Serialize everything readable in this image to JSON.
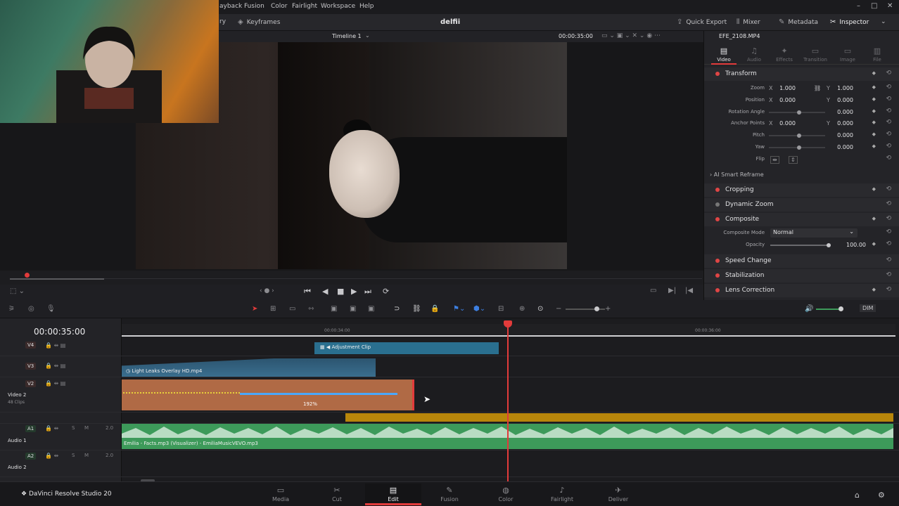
{
  "menu": {
    "items": [
      "ayback",
      "Fusion",
      "Color",
      "Fairlight",
      "Workspace",
      "Help"
    ]
  },
  "window": {
    "minimize": "–",
    "maximize": "□",
    "close": "✕"
  },
  "toolbar": {
    "left_label": "ry",
    "keyframes": "Keyframes",
    "project_title": "delfii",
    "quick_export": "Quick Export",
    "mixer": "Mixer",
    "metadata": "Metadata",
    "inspector": "Inspector"
  },
  "viewer": {
    "timeline_name": "Timeline 1",
    "timecode": "00:00:35:00",
    "clip_name": "EFE_2108.MP4",
    "nav": "‹ ● ›"
  },
  "inspector": {
    "tabs": [
      {
        "label": "Video",
        "icon": "▤"
      },
      {
        "label": "Audio",
        "icon": "♫"
      },
      {
        "label": "Effects",
        "icon": "✦"
      },
      {
        "label": "Transition",
        "icon": "▭"
      },
      {
        "label": "Image",
        "icon": "▭"
      },
      {
        "label": "File",
        "icon": "▥"
      }
    ],
    "transform": "Transform",
    "zoom": {
      "label": "Zoom",
      "x": "1.000",
      "y": "1.000"
    },
    "position": {
      "label": "Position",
      "x": "0.000",
      "y": "0.000"
    },
    "rotation": {
      "label": "Rotation Angle",
      "value": "0.000"
    },
    "anchor": {
      "label": "Anchor Points",
      "x": "0.000",
      "y": "0.000"
    },
    "pitch": {
      "label": "Pitch",
      "value": "0.000"
    },
    "yaw": {
      "label": "Yaw",
      "value": "0.000"
    },
    "flip": {
      "label": "Flip"
    },
    "x_axis": "X",
    "y_axis": "Y",
    "ai_reframe": "AI Smart Reframe",
    "cropping": "Cropping",
    "dynamic_zoom": "Dynamic Zoom",
    "composite": "Composite",
    "composite_mode": {
      "label": "Composite Mode",
      "value": "Normal"
    },
    "opacity": {
      "label": "Opacity",
      "value": "100.00"
    },
    "speed_change": "Speed Change",
    "stabilization": "Stabilization",
    "lens_correction": "Lens Correction"
  },
  "timeline": {
    "timecode": "00:00:35:00",
    "ruler_ticks": [
      "00:00:34:00",
      "00:00:36:00"
    ],
    "tracks": {
      "v4": {
        "id": "V4"
      },
      "v3": {
        "id": "V3"
      },
      "v2": {
        "id": "V2",
        "name": "Video 2",
        "clips": "48 Clips"
      },
      "a1": {
        "id": "A1",
        "name": "Audio 1",
        "level": "2.0",
        "s": "S",
        "m": "M"
      },
      "a2": {
        "id": "A2",
        "name": "Audio 2",
        "level": "2.0",
        "s": "S",
        "m": "M"
      }
    },
    "clips": {
      "adjustment": "Adjustment Clip",
      "light_leaks": "Light Leaks Overlay HD.mp4",
      "speed": "192%",
      "audio": "Emilia - Facts.mp3 (Visualizer) - EmiliaMusicVEVO.mp3"
    },
    "dim": "DIM"
  },
  "app": {
    "name": "DaVinci Resolve Studio 20"
  },
  "pages": [
    {
      "label": "Media",
      "icon": "▭"
    },
    {
      "label": "Cut",
      "icon": "✂"
    },
    {
      "label": "Edit",
      "icon": "▤"
    },
    {
      "label": "Fusion",
      "icon": "✎"
    },
    {
      "label": "Color",
      "icon": "◍"
    },
    {
      "label": "Fairlight",
      "icon": "♪"
    },
    {
      "label": "Deliver",
      "icon": "✈"
    }
  ],
  "colors": {
    "accent": "#e23b3b",
    "adjustment": "#2a6f8f",
    "light_leaks": "#3a6e8e",
    "video_clip": "#b06a45",
    "audio": "#3d9a5a",
    "gold": "#b8860b"
  }
}
